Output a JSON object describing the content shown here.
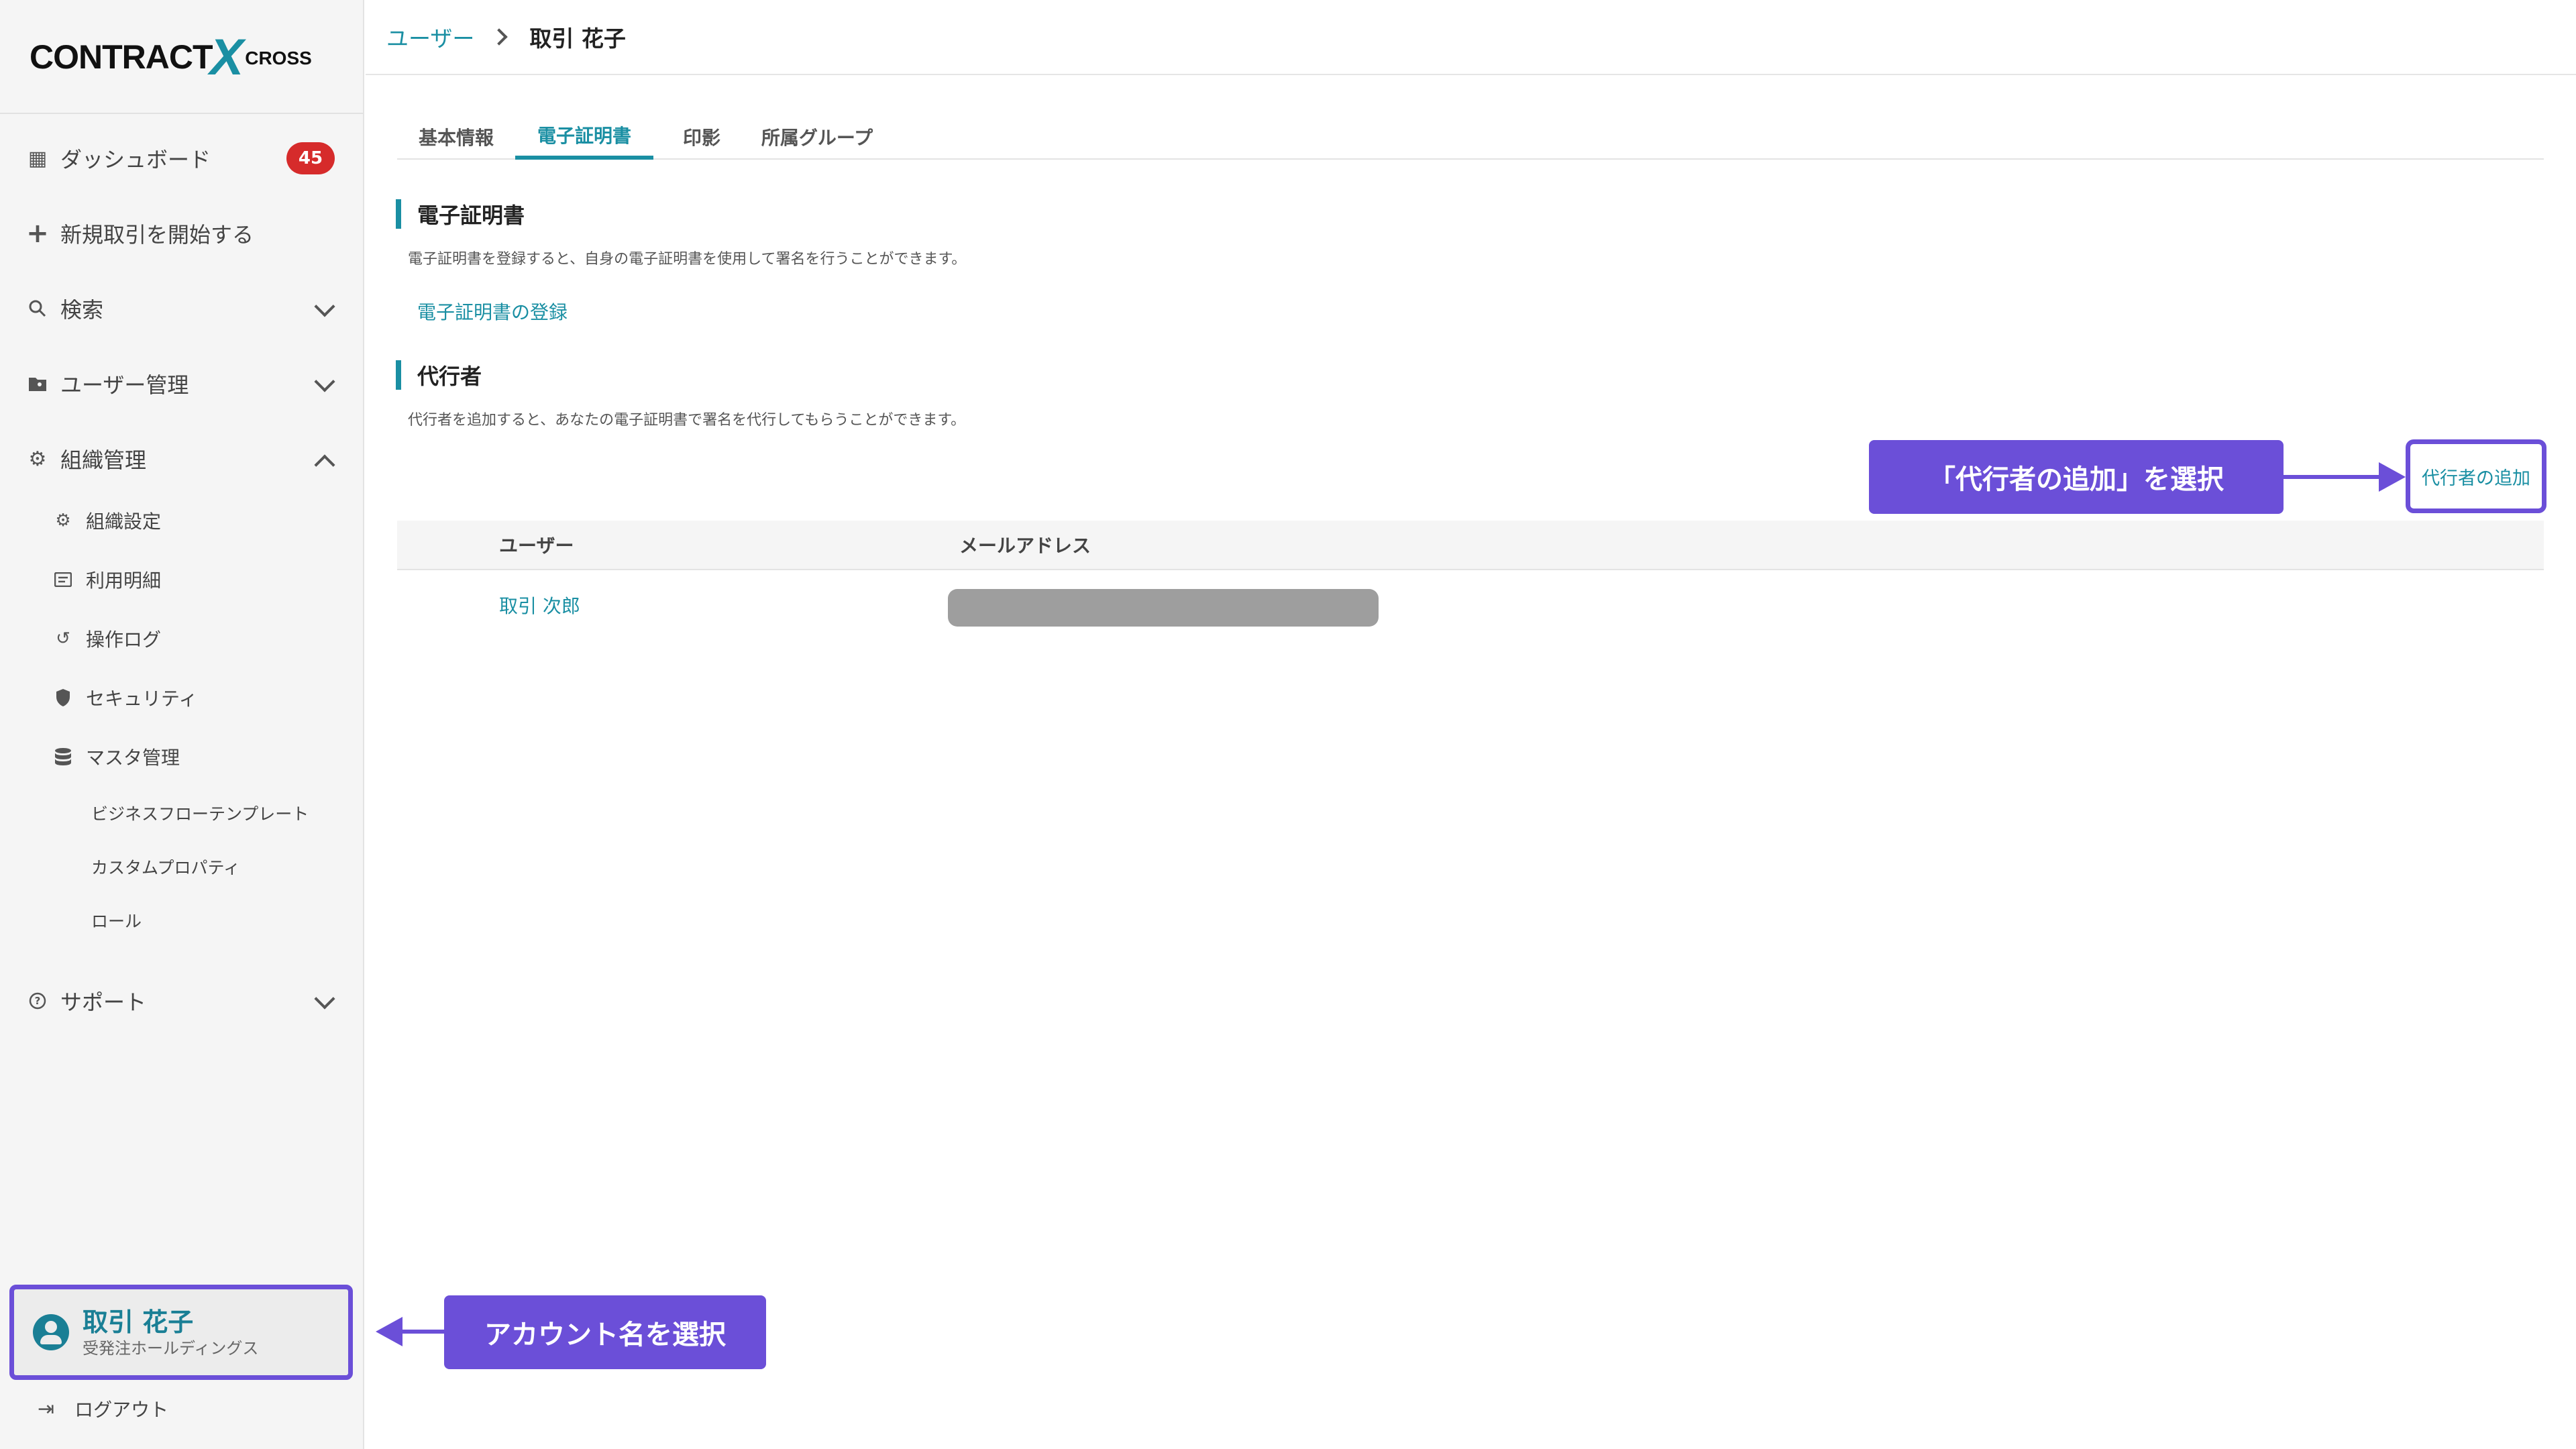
{
  "logo": {
    "part1": "CONTRACT",
    "part2": "X",
    "part3": "CROSS"
  },
  "sidebar": {
    "dashboard": {
      "label": "ダッシュボード",
      "badge": "45"
    },
    "new_deal": {
      "label": "新規取引を開始する"
    },
    "search": {
      "label": "検索"
    },
    "user_mgmt": {
      "label": "ユーザー管理"
    },
    "org_mgmt": {
      "label": "組織管理"
    },
    "org_items": [
      {
        "label": "組織設定"
      },
      {
        "label": "利用明細"
      },
      {
        "label": "操作ログ"
      },
      {
        "label": "セキュリティ"
      },
      {
        "label": "マスタ管理"
      }
    ],
    "master_items": [
      {
        "label": "ビジネスフローテンプレート"
      },
      {
        "label": "カスタムプロパティ"
      },
      {
        "label": "ロール"
      }
    ],
    "support": {
      "label": "サポート"
    },
    "account": {
      "name": "取引 花子",
      "org": "受発注ホールディングス"
    },
    "logout": {
      "label": "ログアウト"
    }
  },
  "breadcrumb": {
    "parent": "ユーザー",
    "current": "取引 花子"
  },
  "tabs": [
    {
      "label": "基本情報"
    },
    {
      "label": "電子証明書"
    },
    {
      "label": "印影"
    },
    {
      "label": "所属グループ"
    }
  ],
  "cert_section": {
    "title": "電子証明書",
    "description": "電子証明書を登録すると、自身の電子証明書を使用して署名を行うことができます。",
    "register_link": "電子証明書の登録"
  },
  "proxy_section": {
    "title": "代行者",
    "description": "代行者を追加すると、あなたの電子証明書で署名を代行してもらうことができます。",
    "add_link": "代行者の追加",
    "table": {
      "headers": [
        "ユーザー",
        "メールアドレス"
      ],
      "rows": [
        {
          "user": "取引 次郎"
        }
      ]
    }
  },
  "annotations": {
    "add_proxy": "「代行者の追加」を選択",
    "account": "アカウント名を選択"
  },
  "colors": {
    "accent": "#1a8fa3",
    "annotation": "#6b4fd8",
    "badge": "#d62b2b"
  }
}
